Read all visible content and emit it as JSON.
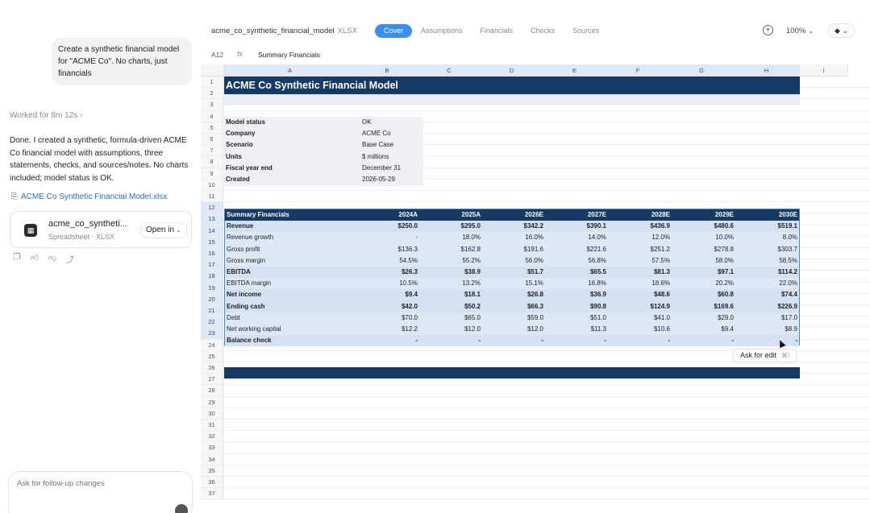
{
  "chat": {
    "user_message": "Create a synthetic financial model for \"ACME Co\". No charts, just financials",
    "worked_label": "Worked for 8m 12s",
    "assistant_message": "Done. I created a synthetic, formula-driven ACME Co financial model with assumptions, three statements, checks, and sources/notes. No charts included; model status is OK.",
    "file_link_label": "ACME Co Synthetic Financial Model.xlsx",
    "file_card": {
      "name": "acme_co_syntheti...",
      "type": "Spreadsheet · XLSX",
      "open_label": "Open in"
    },
    "followup_placeholder": "Ask for follow-up changes"
  },
  "sheet": {
    "doc_name": "acme_co_synthetic_financial_model",
    "doc_ext": "XLSX",
    "tabs": [
      {
        "label": "Cover"
      },
      {
        "label": "Assumptions"
      },
      {
        "label": "Financials"
      },
      {
        "label": "Checks"
      },
      {
        "label": "Sources"
      }
    ],
    "zoom": "100%",
    "cell_ref": "A12",
    "fx_symbol": "fx",
    "formula": "Summary Financials",
    "columns": [
      "A",
      "B",
      "C",
      "D",
      "E",
      "F",
      "G",
      "H",
      "I"
    ],
    "rows": [
      "1",
      "2",
      "3",
      "4",
      "5",
      "6",
      "7",
      "8",
      "9",
      "10",
      "11",
      "12",
      "13",
      "14",
      "15",
      "16",
      "17",
      "18",
      "19",
      "20",
      "21",
      "22",
      "23",
      "24",
      "25",
      "26",
      "27",
      "28",
      "29",
      "30",
      "31",
      "32",
      "33",
      "34",
      "35",
      "36",
      "37"
    ],
    "title": "ACME Co Synthetic Financial Model",
    "info": [
      {
        "key": "Model status",
        "value": "OK"
      },
      {
        "key": "Company",
        "value": "ACME Co"
      },
      {
        "key": "Scenario",
        "value": "Base Case"
      },
      {
        "key": "Units",
        "value": "$ millions"
      },
      {
        "key": "Fiscal year end",
        "value": "December 31"
      },
      {
        "key": "Created",
        "value": "2026-05-29"
      }
    ],
    "table": {
      "header": [
        "Summary Financials",
        "2024A",
        "2025A",
        "2026E",
        "2027E",
        "2028E",
        "2029E",
        "2030E"
      ],
      "rows": [
        {
          "label": "Revenue",
          "bold": true,
          "values": [
            "$250.0",
            "$295.0",
            "$342.2",
            "$390.1",
            "$436.9",
            "$480.6",
            "$519.1"
          ]
        },
        {
          "label": "Revenue growth",
          "bold": false,
          "values": [
            "-",
            "18.0%",
            "16.0%",
            "14.0%",
            "12.0%",
            "10.0%",
            "8.0%"
          ]
        },
        {
          "label": "Gross profit",
          "bold": false,
          "values": [
            "$136.3",
            "$162.8",
            "$191.6",
            "$221.6",
            "$251.2",
            "$278.8",
            "$303.7"
          ]
        },
        {
          "label": "Gross margin",
          "bold": false,
          "values": [
            "54.5%",
            "55.2%",
            "56.0%",
            "56.8%",
            "57.5%",
            "58.0%",
            "58.5%"
          ]
        },
        {
          "label": "EBITDA",
          "bold": true,
          "values": [
            "$26.3",
            "$38.9",
            "$51.7",
            "$65.5",
            "$81.3",
            "$97.1",
            "$114.2"
          ]
        },
        {
          "label": "EBITDA margin",
          "bold": false,
          "values": [
            "10.5%",
            "13.2%",
            "15.1%",
            "16.8%",
            "18.6%",
            "20.2%",
            "22.0%"
          ]
        },
        {
          "label": "Net income",
          "bold": true,
          "values": [
            "$9.4",
            "$18.1",
            "$26.8",
            "$36.9",
            "$48.6",
            "$60.8",
            "$74.4"
          ]
        },
        {
          "label": "Ending cash",
          "bold": true,
          "values": [
            "$42.0",
            "$50.2",
            "$66.3",
            "$90.8",
            "$124.9",
            "$169.6",
            "$226.9"
          ]
        },
        {
          "label": "Debt",
          "bold": false,
          "values": [
            "$70.0",
            "$65.0",
            "$59.0",
            "$51.0",
            "$41.0",
            "$29.0",
            "$17.0"
          ]
        },
        {
          "label": "Net working capital",
          "bold": false,
          "values": [
            "$12.2",
            "$12.0",
            "$12.0",
            "$11.3",
            "$10.6",
            "$9.4",
            "$8.9"
          ]
        },
        {
          "label": "Balance check",
          "bold": true,
          "values": [
            "-",
            "-",
            "-",
            "-",
            "-",
            "-",
            "-"
          ]
        }
      ]
    },
    "ask_edit_label": "Ask for edit",
    "ask_edit_shortcut": "⌘I"
  }
}
